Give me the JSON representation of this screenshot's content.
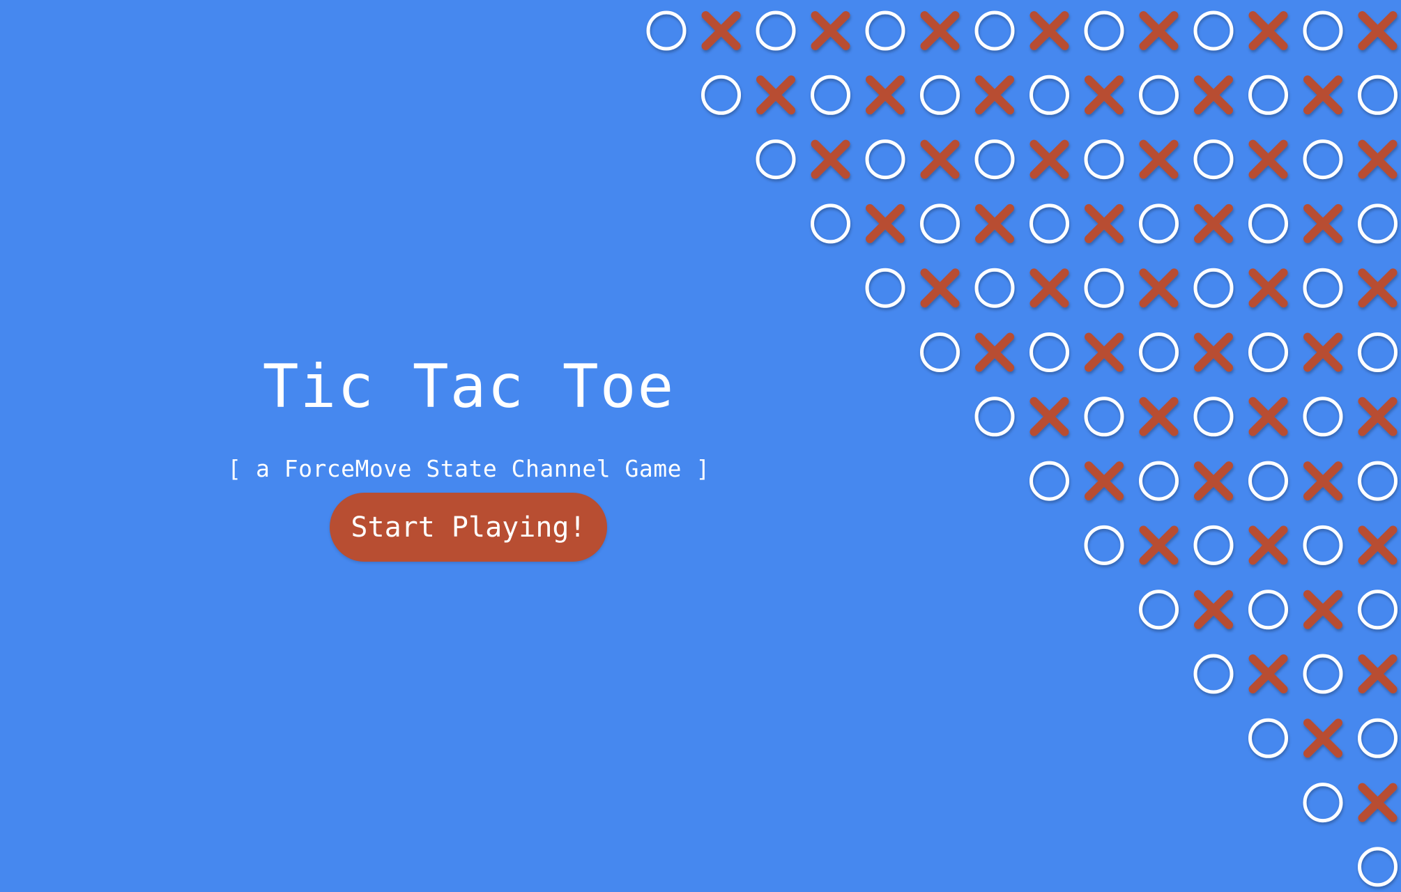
{
  "app": {
    "title": "Tic Tac Toe",
    "subtitle": "[ a ForceMove State Channel Game ]",
    "start_button": "Start Playing!"
  },
  "colors": {
    "background": "#4688ef",
    "accent": "#b84e32",
    "cross": "#b84e32",
    "nought": "#ffffff",
    "text": "#ffffff"
  },
  "icons": {
    "nought": "nought-icon",
    "cross": "cross-icon"
  }
}
